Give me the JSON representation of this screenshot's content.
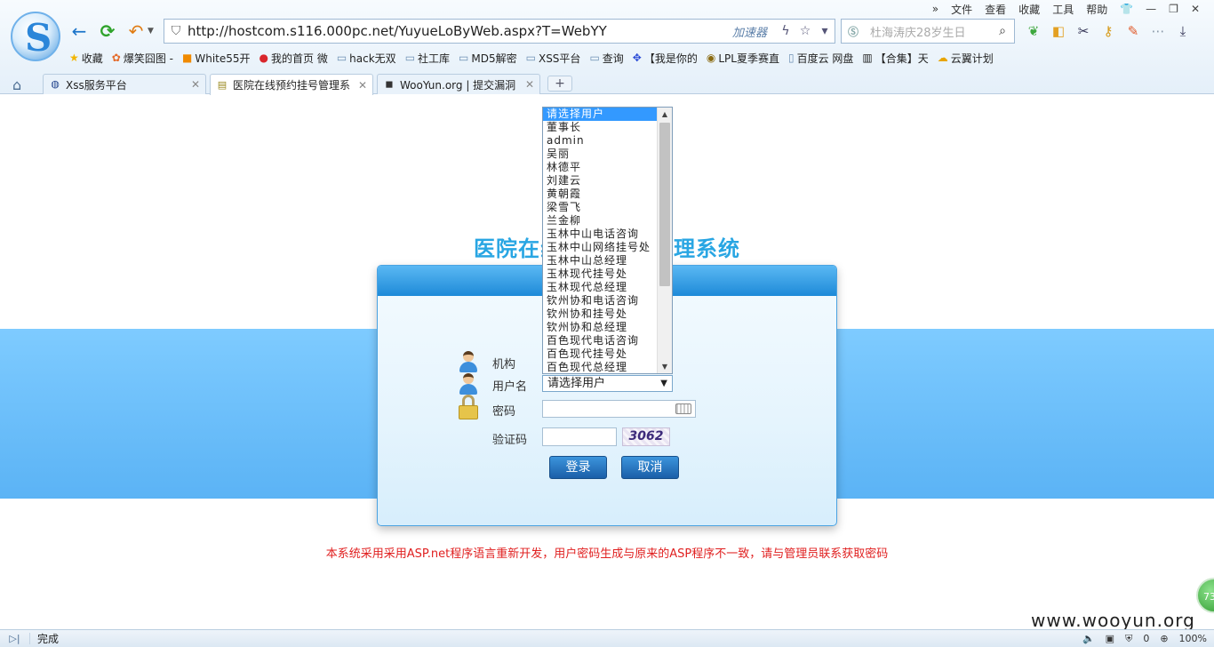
{
  "browser": {
    "menu": [
      "文件",
      "查看",
      "收藏",
      "工具",
      "帮助"
    ],
    "address": "http://hostcom.s116.000pc.net/YuyueLoByWeb.aspx?T=WebYY",
    "accelerator": "加速器",
    "search_placeholder": "杜海涛庆28岁生日",
    "bookmarks": [
      "收藏",
      "爆笑囧图 -",
      "White55开",
      "我的首页 微",
      "hack无双",
      "社工库",
      "MD5解密",
      "XSS平台",
      "查询",
      "【我是你的",
      "LPL夏季赛直",
      "百度云 网盘",
      "【合集】天",
      "云翼计划"
    ],
    "tabs": [
      {
        "label": "Xss服务平台"
      },
      {
        "label": "医院在线预约挂号管理系"
      },
      {
        "label": "WooYun.org | 提交漏洞"
      }
    ],
    "tab_new": "+",
    "status_text": "完成",
    "status_counter": "0",
    "zoom": "100%"
  },
  "page": {
    "title": "医院在线预约挂号管理系统",
    "labels": {
      "org": "机构",
      "username": "用户名",
      "password": "密码",
      "captcha": "验证码"
    },
    "user_select_value": "请选择用户",
    "captcha_text": "3062",
    "login_button": "登录",
    "cancel_button": "取消",
    "notice": "本系统采用采用ASP.net程序语言重新开发，用户密码生成与原来的ASP程序不一致，请与管理员联系获取密码",
    "dropdown_options": [
      "请选择用户",
      "董事长",
      "admin",
      "吴丽",
      "林德平",
      "刘建云",
      "黄朝霞",
      "梁雪飞",
      "兰金柳",
      "玉林中山电话咨询",
      "玉林中山网络挂号处",
      "玉林中山总经理",
      "玉林现代挂号处",
      "玉林现代总经理",
      "钦州协和电话咨询",
      "钦州协和挂号处",
      "钦州协和总经理",
      "百色现代电话咨询",
      "百色现代挂号处",
      "百色现代总经理"
    ],
    "badge": "73",
    "watermark": "www.wooyun.org"
  }
}
